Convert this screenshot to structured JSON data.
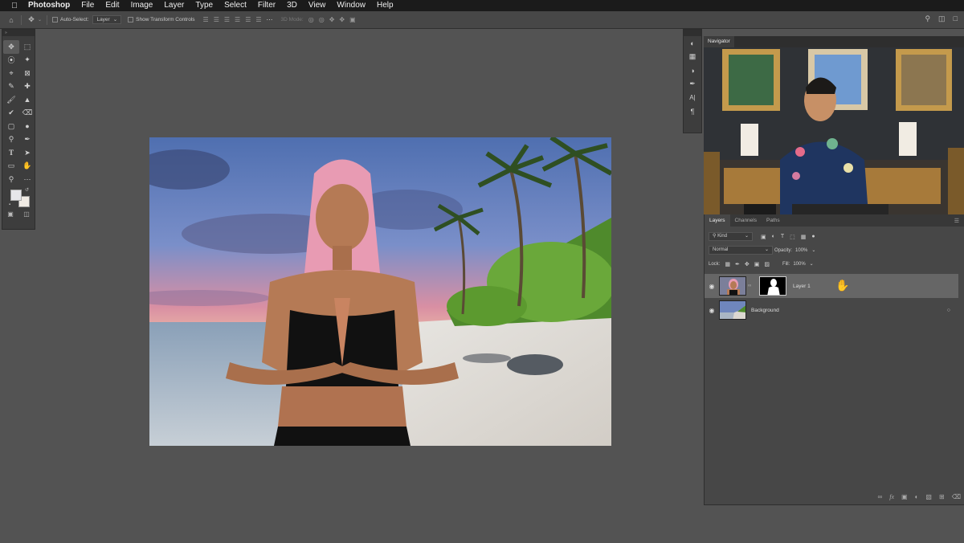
{
  "menubar": {
    "apple": "",
    "app": "Photoshop",
    "items": [
      "File",
      "Edit",
      "Image",
      "Layer",
      "Type",
      "Select",
      "Filter",
      "3D",
      "View",
      "Window",
      "Help"
    ]
  },
  "options": {
    "auto_select": "Auto-Select:",
    "auto_select_target": "Layer",
    "show_transform": "Show Transform Controls",
    "mode_3d": "3D Mode:"
  },
  "navigator": {
    "tab": "Navigator"
  },
  "layers_panel": {
    "tabs": [
      "Layers",
      "Channels",
      "Paths"
    ],
    "filter_kind": "Kind",
    "blend_mode": "Normal",
    "opacity_label": "Opacity:",
    "opacity_value": "100%",
    "lock_label": "Lock:",
    "fill_label": "Fill:",
    "fill_value": "100%",
    "layers": [
      {
        "name": "Layer 1",
        "selected": true
      },
      {
        "name": "Background",
        "selected": false
      }
    ]
  },
  "icons": {
    "apple": "apple-icon",
    "home": "home-icon",
    "move": "move-tool-icon",
    "search": "search-icon",
    "eye": "eye-icon",
    "lock": "lock-icon",
    "hand": "hand-cursor-icon"
  }
}
